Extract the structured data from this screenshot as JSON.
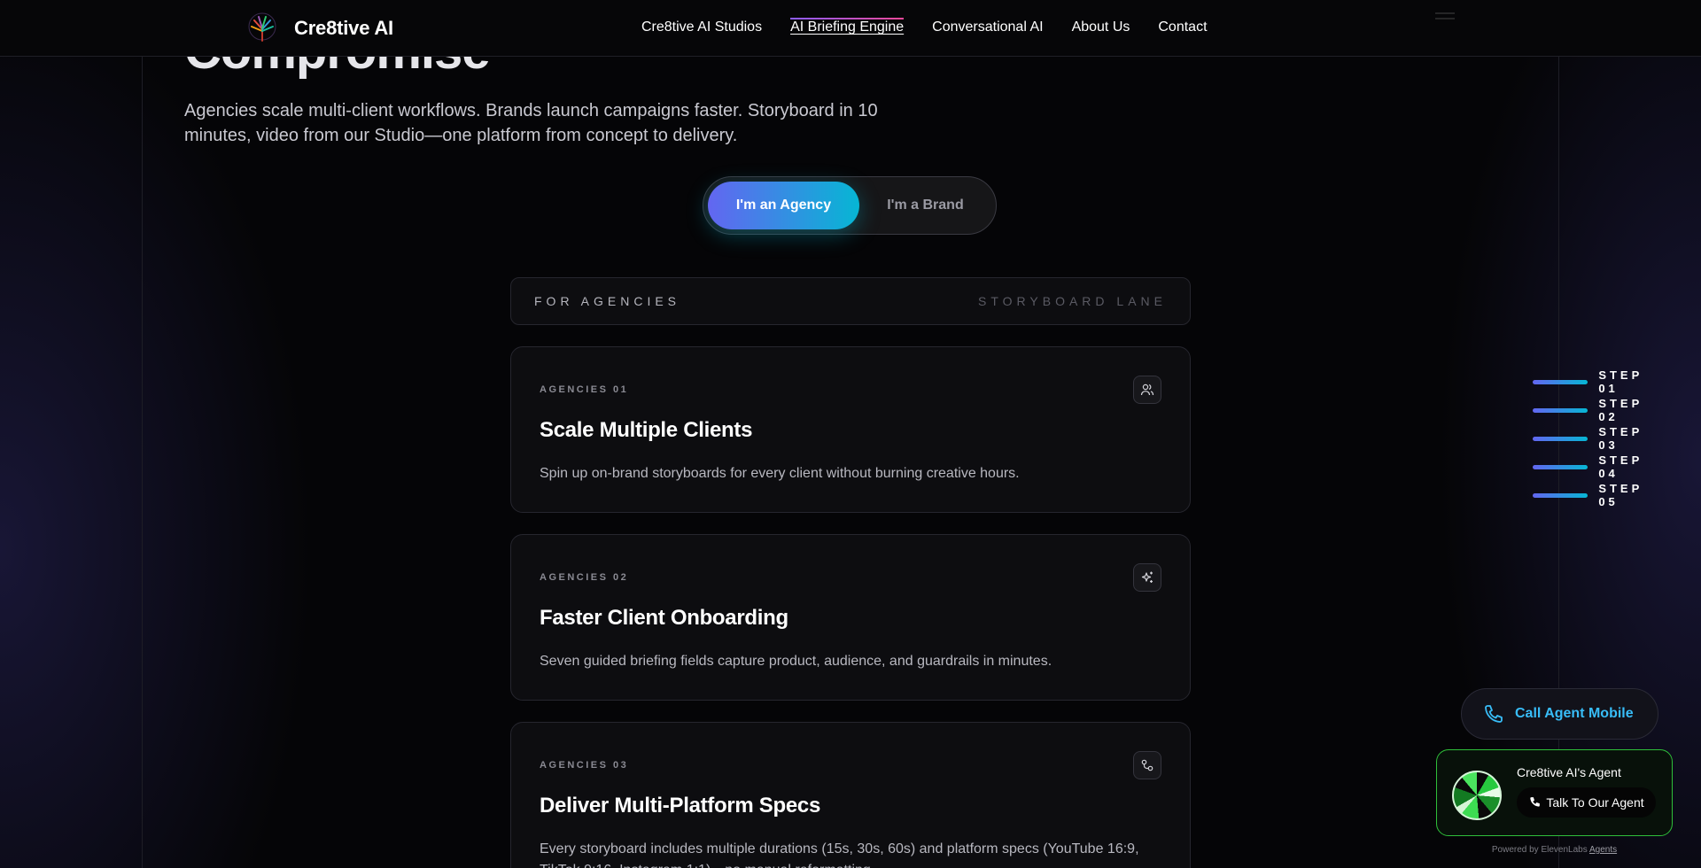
{
  "header": {
    "brand": "Cre8tive AI",
    "nav": [
      {
        "label": "Cre8tive AI Studios",
        "active": false
      },
      {
        "label": "AI Briefing Engine",
        "active": true
      },
      {
        "label": "Conversational AI",
        "active": false
      },
      {
        "label": "About Us",
        "active": false
      },
      {
        "label": "Contact",
        "active": false
      }
    ]
  },
  "hero": {
    "title": "Compromise",
    "subtitle": "Agencies scale multi-client workflows. Brands launch campaigns faster. Storyboard in 10 minutes, video from our Studio—one platform from concept to delivery."
  },
  "toggle": {
    "agency_label": "I'm an Agency",
    "brand_label": "I'm a Brand",
    "selected": "agency"
  },
  "lane": {
    "left": "FOR AGENCIES",
    "right": "STORYBOARD LANE"
  },
  "cards": [
    {
      "kicker": "AGENCIES 01",
      "title": "Scale Multiple Clients",
      "desc": "Spin up on-brand storyboards for every client without burning creative hours.",
      "icon": "users-icon"
    },
    {
      "kicker": "AGENCIES 02",
      "title": "Faster Client Onboarding",
      "desc": "Seven guided briefing fields capture product, audience, and guardrails in minutes.",
      "icon": "sparkles-icon"
    },
    {
      "kicker": "AGENCIES 03",
      "title": "Deliver Multi-Platform Specs",
      "desc": "Every storyboard includes multiple durations (15s, 30s, 60s) and platform specs (YouTube 16:9, TikTok 9:16, Instagram 1:1)—no manual reformatting.",
      "icon": "share-icon"
    }
  ],
  "steps": [
    "STEP 01",
    "STEP 02",
    "STEP 03",
    "STEP 04",
    "STEP 05"
  ],
  "call_agent": {
    "label": "Call Agent Mobile",
    "icon": "phone-icon"
  },
  "agent_widget": {
    "name": "Cre8tive AI's Agent",
    "button": "Talk To Our Agent",
    "powered_prefix": "Powered by ElevenLabs",
    "powered_link": "Agents"
  },
  "colors": {
    "accent_start": "#6366f1",
    "accent_end": "#06b6d4",
    "nav_active": "#ec4899",
    "call_text": "#38bdf8",
    "widget_border": "#2fbf3a"
  }
}
